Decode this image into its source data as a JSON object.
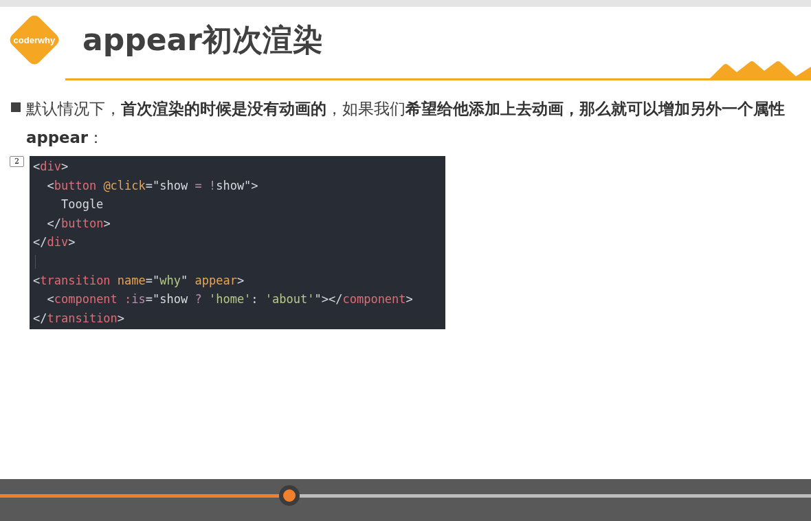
{
  "slide": {
    "logo": "coderwhy",
    "title": "appear初次渲染",
    "bullet": "默认情况下，**首次渲染的时候是没有动画的**，如果我们**希望给他添加上去动画，那么就可以增加另外一个属性 appear**：",
    "slide_number": "2",
    "code": [
      {
        "kind": "code",
        "tokens": [
          {
            "text": "<",
            "kind": "punct"
          },
          {
            "text": "div",
            "kind": "tag"
          },
          {
            "text": ">",
            "kind": "punct"
          }
        ]
      },
      {
        "kind": "code",
        "tokens": [
          {
            "text": "  <",
            "kind": "punct"
          },
          {
            "text": "button ",
            "kind": "tag"
          },
          {
            "text": "@click",
            "kind": "attr"
          },
          {
            "text": "=\"show ",
            "kind": "punct"
          },
          {
            "text": "= !",
            "kind": "op"
          },
          {
            "text": "show\">",
            "kind": "punct"
          }
        ]
      },
      {
        "kind": "code",
        "tokens": [
          {
            "text": "    Toogle",
            "kind": "punct"
          }
        ]
      },
      {
        "kind": "code",
        "tokens": [
          {
            "text": "  </",
            "kind": "punct"
          },
          {
            "text": "button",
            "kind": "tag"
          },
          {
            "text": ">",
            "kind": "punct"
          }
        ]
      },
      {
        "kind": "code",
        "tokens": [
          {
            "text": "</",
            "kind": "punct"
          },
          {
            "text": "div",
            "kind": "tag"
          },
          {
            "text": ">",
            "kind": "punct"
          }
        ]
      },
      {
        "kind": "blank"
      },
      {
        "kind": "code",
        "tokens": [
          {
            "text": "<",
            "kind": "punct"
          },
          {
            "text": "transition ",
            "kind": "tag"
          },
          {
            "text": "name",
            "kind": "attr"
          },
          {
            "text": "=\"",
            "kind": "punct"
          },
          {
            "text": "why",
            "kind": "str"
          },
          {
            "text": "\" ",
            "kind": "punct"
          },
          {
            "text": "appear",
            "kind": "attr"
          },
          {
            "text": ">",
            "kind": "punct"
          }
        ]
      },
      {
        "kind": "code",
        "tokens": [
          {
            "text": "  <",
            "kind": "punct"
          },
          {
            "text": "component :",
            "kind": "tag"
          },
          {
            "text": "is",
            "kind": "op"
          },
          {
            "text": "=\"show ",
            "kind": "punct"
          },
          {
            "text": "? ",
            "kind": "op"
          },
          {
            "text": "'home'",
            "kind": "str"
          },
          {
            "text": ": ",
            "kind": "punct"
          },
          {
            "text": "'about'",
            "kind": "str"
          },
          {
            "text": "\"></",
            "kind": "punct"
          },
          {
            "text": "component",
            "kind": "tag"
          },
          {
            "text": ">",
            "kind": "punct"
          }
        ]
      },
      {
        "kind": "code",
        "tokens": [
          {
            "text": "</",
            "kind": "punct"
          },
          {
            "text": "transition",
            "kind": "tag"
          },
          {
            "text": ">",
            "kind": "punct"
          }
        ]
      }
    ]
  },
  "player": {
    "progress": {
      "level": 0.357
    }
  }
}
